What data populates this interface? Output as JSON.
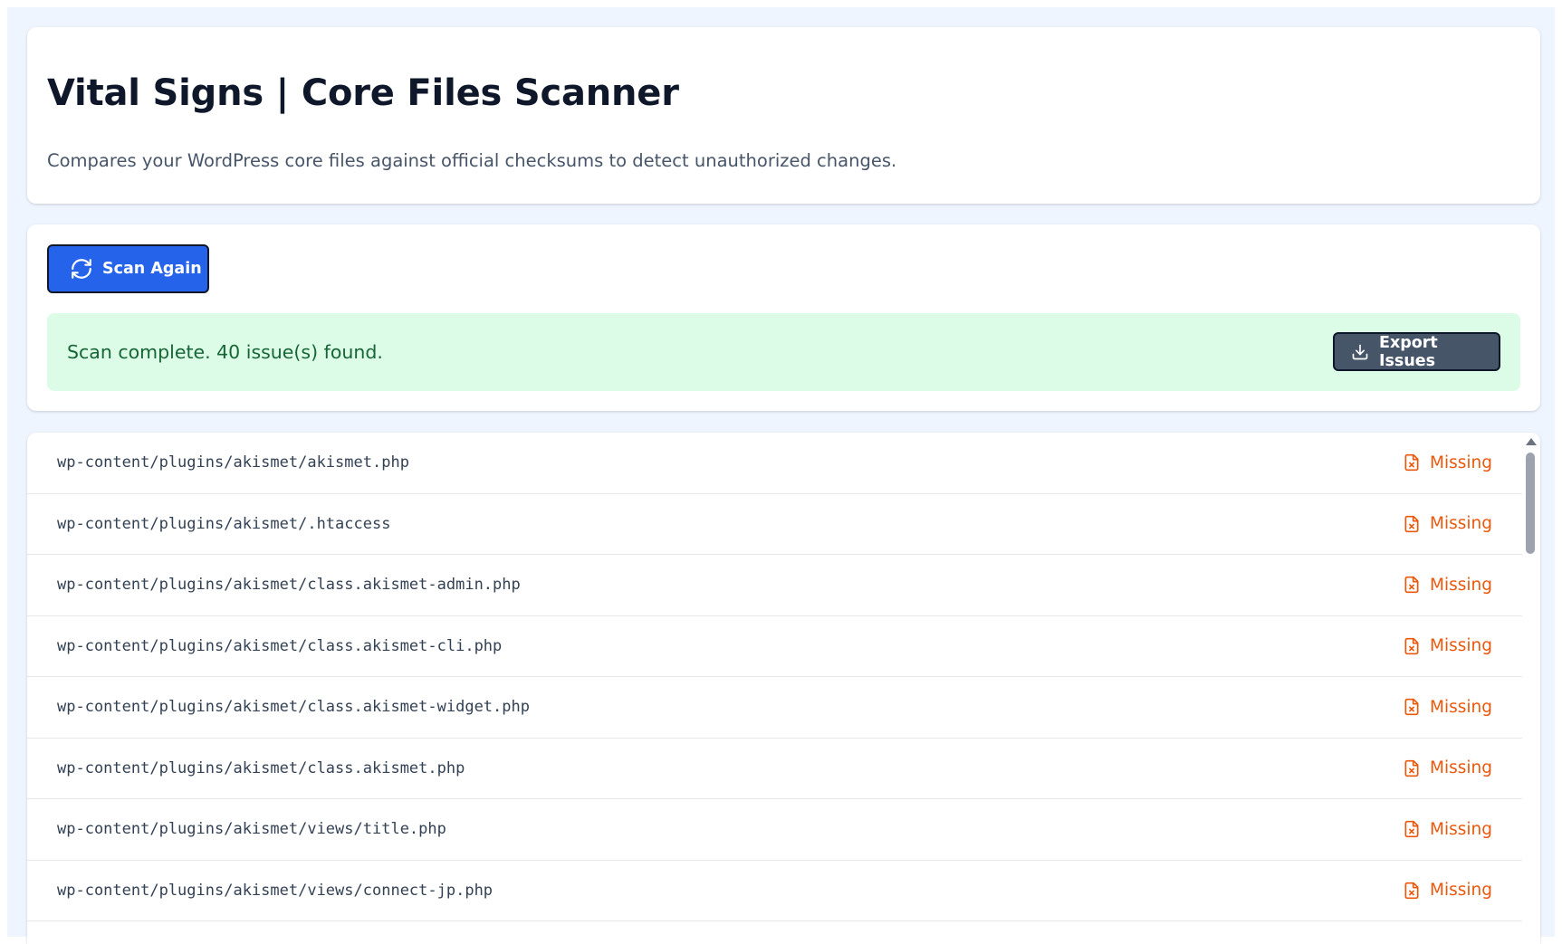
{
  "header": {
    "title": "Vital Signs | Core Files Scanner",
    "description": "Compares your WordPress core files against official checksums to detect unauthorized changes."
  },
  "actions": {
    "scan_again_label": "Scan Again",
    "scan_icon": "refresh-icon",
    "status_message": "Scan complete. 40 issue(s) found.",
    "export_label": "Export Issues",
    "export_icon": "download-icon"
  },
  "issues": [
    {
      "path": "wp-content/plugins/akismet/akismet.php",
      "status": "Missing",
      "icon": "file-x-icon"
    },
    {
      "path": "wp-content/plugins/akismet/.htaccess",
      "status": "Missing",
      "icon": "file-x-icon"
    },
    {
      "path": "wp-content/plugins/akismet/class.akismet-admin.php",
      "status": "Missing",
      "icon": "file-x-icon"
    },
    {
      "path": "wp-content/plugins/akismet/class.akismet-cli.php",
      "status": "Missing",
      "icon": "file-x-icon"
    },
    {
      "path": "wp-content/plugins/akismet/class.akismet-widget.php",
      "status": "Missing",
      "icon": "file-x-icon"
    },
    {
      "path": "wp-content/plugins/akismet/class.akismet.php",
      "status": "Missing",
      "icon": "file-x-icon"
    },
    {
      "path": "wp-content/plugins/akismet/views/title.php",
      "status": "Missing",
      "icon": "file-x-icon"
    },
    {
      "path": "wp-content/plugins/akismet/views/connect-jp.php",
      "status": "Missing",
      "icon": "file-x-icon"
    }
  ],
  "colors": {
    "primary": "#2563eb",
    "success_bg": "#dcfce7",
    "success_text": "#166534",
    "missing": "#ea580c",
    "export_bg": "#475569"
  }
}
